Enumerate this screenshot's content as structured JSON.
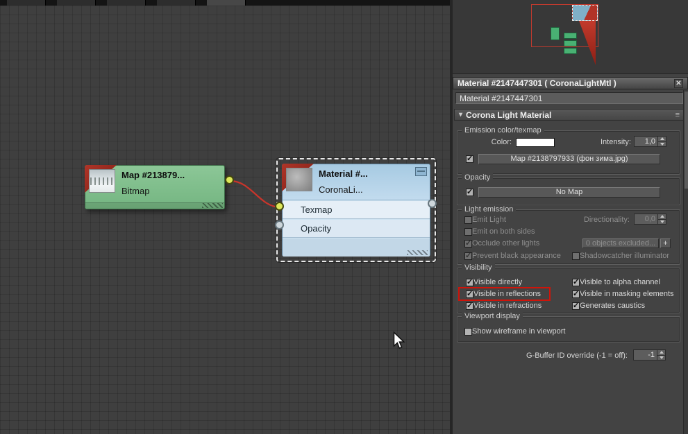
{
  "node_editor": {
    "bitmap_node": {
      "title": "Map  #213879...",
      "subtitle": "Bitmap"
    },
    "corona_node": {
      "title": "Material  #...",
      "subtitle": "CoronaLi...",
      "minimize": "—",
      "slot_texmap": "Texmap",
      "slot_opacity": "Opacity"
    }
  },
  "material_panel": {
    "title": "Material #2147447301  ( CoronaLightMtl )",
    "close": "✕",
    "name_field": "Material #2147447301",
    "rollout_arrow": "▾",
    "rollout_title": "Corona Light Material",
    "rollout_menu": "≡",
    "emission": {
      "group": "Emission color/texmap",
      "color_label": "Color:",
      "intensity_label": "Intensity:",
      "intensity_value": "1,0",
      "map_button": "Map #2138797933 (фон зима.jpg)"
    },
    "opacity": {
      "group": "Opacity",
      "map_button": "No Map"
    },
    "light": {
      "group": "Light emission",
      "emit_light": "Emit Light",
      "directionality_label": "Directionality:",
      "directionality_value": "0,0",
      "emit_both": "Emit on both sides",
      "occlude": "Occlude other lights",
      "excluded_button": "0 objects excluded...",
      "excluded_more": "+",
      "prevent_black": "Prevent black appearance",
      "shadowcatcher": "Shadowcatcher illuminator"
    },
    "visibility": {
      "group": "Visibility",
      "left": [
        "Visible directly",
        "Visible in reflections",
        "Visible in refractions"
      ],
      "right": [
        "Visible to alpha channel",
        "Visible in masking elements",
        "Generates caustics"
      ]
    },
    "viewport": {
      "group": "Viewport display",
      "wireframe": "Show wireframe in viewport"
    },
    "gbuffer": {
      "label": "G-Buffer ID override (-1 = off):",
      "value": "-1"
    }
  }
}
